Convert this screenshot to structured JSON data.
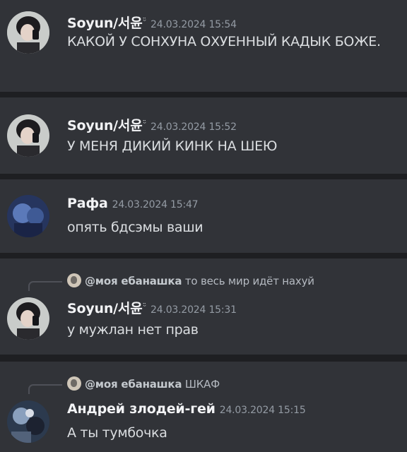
{
  "messages": [
    {
      "author": "Soyun/서윤",
      "badge": "ᵕ̈",
      "timestamp": "24.03.2024 15:54",
      "text": "КАКОЙ У СОНХУНА ОХУЕННЫЙ КАДЫК БОЖЕ.",
      "avatar": "soyun-avatar"
    },
    {
      "author": "Soyun/서윤",
      "badge": "ᵕ̈",
      "timestamp": "24.03.2024 15:52",
      "text": "У МЕНЯ ДИКИЙ КИНК НА ШЕЮ",
      "avatar": "soyun-avatar"
    },
    {
      "author": "Рафа",
      "timestamp": "24.03.2024 15:47",
      "text": "опять бдсэмы ваши",
      "avatar": "rafa-avatar"
    },
    {
      "reply_to": {
        "name": "@моя ебанашка",
        "text": "то весь мир идёт нахуй"
      },
      "author": "Soyun/서윤",
      "badge": "ᵕ̈",
      "timestamp": "24.03.2024 15:31",
      "text": "у мужлан нет прав",
      "avatar": "soyun-avatar"
    },
    {
      "reply_to": {
        "name": "@моя ебанашка",
        "text": "ШКАФ"
      },
      "author": "Андрей злодей-гей",
      "timestamp": "24.03.2024 15:15",
      "text": "А ты тумбочка",
      "avatar": "andrey-avatar"
    }
  ],
  "colors": {
    "background": "#313338",
    "separator": "#1e1f22",
    "username": "#f2f3f5",
    "timestamp": "#949ba4",
    "text": "#dbdee1"
  }
}
